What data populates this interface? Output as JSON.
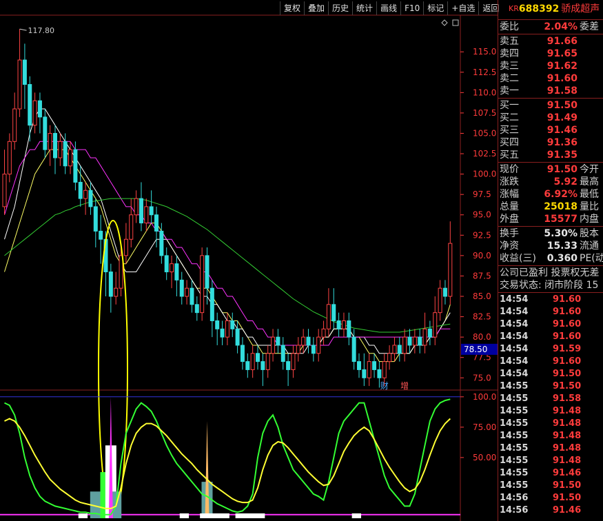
{
  "toolbar": [
    "复权",
    "叠加",
    "历史",
    "统计",
    "画线",
    "F10",
    "标记",
    "+自选",
    "返回"
  ],
  "chart_data": {
    "type": "candlestick",
    "price_axis": [
      115.0,
      112.5,
      110.0,
      107.5,
      105.0,
      102.5,
      100.0,
      97.5,
      95.0,
      92.5,
      90.0,
      87.5,
      85.0,
      82.5,
      80.0,
      77.5,
      75.0
    ],
    "ylim": [
      73.5,
      119.5
    ],
    "max_label": "117.80",
    "current_tag": "78.50",
    "markers": [
      "财",
      "增"
    ],
    "candles": [
      [
        96,
        100,
        95,
        103
      ],
      [
        100,
        104,
        99,
        105
      ],
      [
        104,
        108,
        103,
        110
      ],
      [
        108,
        114,
        107,
        117.8
      ],
      [
        114,
        111,
        108,
        116
      ],
      [
        111,
        106,
        104,
        112
      ],
      [
        106,
        109,
        105,
        110
      ],
      [
        109,
        107,
        105,
        110
      ],
      [
        107,
        103,
        102,
        108
      ],
      [
        103,
        105,
        101,
        106
      ],
      [
        105,
        102,
        100,
        106
      ],
      [
        102,
        104,
        101,
        105
      ],
      [
        104,
        101,
        100,
        105
      ],
      [
        101,
        103,
        100,
        104
      ],
      [
        103,
        99,
        98,
        104
      ],
      [
        99,
        97,
        96,
        101
      ],
      [
        97,
        98,
        95,
        99
      ],
      [
        98,
        96,
        95,
        99
      ],
      [
        96,
        93,
        91,
        97
      ],
      [
        93,
        92,
        89,
        95
      ],
      [
        92,
        88,
        85,
        93
      ],
      [
        88,
        85,
        83,
        89
      ],
      [
        85,
        86,
        84,
        88
      ],
      [
        86,
        90,
        85,
        91
      ],
      [
        90,
        92,
        89,
        94
      ],
      [
        92,
        95,
        91,
        97
      ],
      [
        95,
        97,
        94,
        98
      ],
      [
        97,
        94,
        93,
        99
      ],
      [
        94,
        96,
        93,
        97
      ],
      [
        96,
        95,
        94,
        98
      ],
      [
        95,
        93,
        91,
        96
      ],
      [
        93,
        90,
        89,
        94
      ],
      [
        90,
        88,
        87,
        91
      ],
      [
        88,
        89,
        86,
        90
      ],
      [
        89,
        87,
        85,
        90
      ],
      [
        87,
        85,
        84,
        88
      ],
      [
        85,
        86,
        84,
        87
      ],
      [
        86,
        84,
        83,
        87
      ],
      [
        84,
        83,
        82,
        85
      ],
      [
        83,
        90,
        82,
        91
      ],
      [
        90,
        86,
        84,
        91
      ],
      [
        86,
        82,
        80,
        87
      ],
      [
        82,
        81,
        79,
        83
      ],
      [
        81,
        80,
        79,
        82
      ],
      [
        80,
        82,
        79,
        83
      ],
      [
        82,
        81,
        80,
        83
      ],
      [
        81,
        79,
        78,
        82
      ],
      [
        79,
        77,
        76,
        80
      ],
      [
        77,
        76,
        75,
        78
      ],
      [
        76,
        78,
        75,
        79
      ],
      [
        78,
        77,
        76,
        79
      ],
      [
        77,
        76,
        74,
        78
      ],
      [
        76,
        78,
        75,
        79
      ],
      [
        78,
        80,
        77,
        81
      ],
      [
        80,
        79,
        78,
        81
      ],
      [
        79,
        77,
        76,
        80
      ],
      [
        77,
        76,
        74,
        78
      ],
      [
        76,
        78,
        75,
        79
      ],
      [
        78,
        79,
        77,
        80
      ],
      [
        79,
        80,
        78,
        81
      ],
      [
        80,
        79,
        78,
        81
      ],
      [
        79,
        78,
        77,
        80
      ],
      [
        78,
        80,
        77,
        81
      ],
      [
        80,
        81,
        79,
        82
      ],
      [
        81,
        84,
        80,
        86
      ],
      [
        84,
        82,
        81,
        86
      ],
      [
        82,
        81,
        80,
        83
      ],
      [
        81,
        82,
        80,
        83
      ],
      [
        82,
        80,
        79,
        83
      ],
      [
        80,
        77,
        76,
        81
      ],
      [
        77,
        76,
        75,
        78
      ],
      [
        76,
        75,
        74,
        78
      ],
      [
        75,
        77,
        74,
        78
      ],
      [
        77,
        76,
        75,
        78
      ],
      [
        76,
        75,
        73.8,
        77
      ],
      [
        75,
        77,
        74,
        78
      ],
      [
        77,
        78,
        76,
        79
      ],
      [
        78,
        79,
        77,
        80
      ],
      [
        79,
        78,
        77,
        80
      ],
      [
        78,
        80,
        77,
        81
      ],
      [
        80,
        79,
        78,
        81
      ],
      [
        79,
        80,
        78,
        81
      ],
      [
        80,
        79,
        78,
        81
      ],
      [
        79,
        81,
        78,
        83
      ],
      [
        81,
        80,
        79,
        82
      ],
      [
        80,
        83,
        79,
        85
      ],
      [
        83,
        86,
        82,
        87
      ],
      [
        86,
        85,
        84,
        87
      ],
      [
        85,
        91.5,
        84,
        94.2
      ]
    ],
    "ma": {
      "yellow": [
        88,
        90,
        92,
        94,
        96,
        98,
        100,
        101,
        102,
        103,
        103,
        103,
        103,
        102,
        101,
        100,
        99,
        98,
        97,
        96,
        94,
        92,
        90,
        89,
        89,
        90,
        91,
        92,
        93,
        94,
        94,
        93,
        92,
        91,
        90,
        89,
        88,
        87,
        86,
        86,
        86,
        85,
        84,
        83,
        83,
        82,
        82,
        81,
        80,
        79,
        79,
        78,
        78,
        78,
        78,
        78,
        78,
        78,
        78,
        79,
        79,
        79,
        79,
        80,
        80,
        81,
        81,
        81,
        81,
        80,
        80,
        79,
        78,
        78,
        77,
        77,
        77,
        77,
        78,
        78,
        78,
        79,
        79,
        79,
        80,
        80,
        81,
        82,
        84
      ],
      "white": [
        92,
        94,
        96,
        99,
        102,
        105,
        107,
        108,
        108,
        107,
        106,
        105,
        104,
        103,
        102,
        101,
        100,
        99,
        98,
        97,
        95,
        93,
        91,
        89,
        88,
        88,
        88,
        89,
        90,
        91,
        92,
        92,
        92,
        91,
        90,
        89,
        88,
        87,
        86,
        85,
        85,
        84,
        84,
        83,
        82,
        82,
        81,
        81,
        80,
        80,
        79,
        79,
        79,
        79,
        79,
        79,
        78,
        78,
        78,
        78,
        79,
        79,
        79,
        80,
        80,
        81,
        81,
        81,
        81,
        80,
        80,
        80,
        79,
        79,
        78,
        78,
        78,
        78,
        78,
        78,
        78,
        79,
        79,
        79,
        80,
        80,
        81,
        82,
        83
      ],
      "magenta": [
        95,
        97,
        99,
        101,
        102,
        103,
        103,
        104,
        104,
        104,
        104,
        104,
        104,
        104,
        103,
        103,
        103,
        102,
        102,
        101,
        100,
        99,
        98,
        97,
        96,
        96,
        95,
        95,
        94,
        94,
        93,
        93,
        92,
        92,
        91,
        91,
        90,
        89,
        89,
        88,
        88,
        87,
        86,
        86,
        85,
        85,
        84,
        83,
        82,
        82,
        81,
        81,
        80,
        80,
        79,
        79,
        79,
        79,
        79,
        79,
        79,
        79,
        79,
        79,
        79,
        80,
        80,
        80,
        80,
        80,
        80,
        80,
        80,
        80,
        80,
        80,
        80,
        80,
        80,
        80,
        80,
        80,
        80,
        80,
        80,
        80,
        81,
        81,
        81
      ],
      "green": [
        90,
        90.5,
        91,
        91.5,
        92,
        92.5,
        93,
        93.5,
        94,
        94.5,
        95,
        95.2,
        95.5,
        95.7,
        96,
        96.2,
        96.4,
        96.6,
        96.7,
        96.8,
        96.9,
        97,
        97,
        97,
        97,
        97,
        97,
        96.9,
        96.8,
        96.6,
        96.4,
        96.2,
        96,
        95.7,
        95.4,
        95.1,
        94.8,
        94.4,
        94,
        93.6,
        93.2,
        92.7,
        92.2,
        91.7,
        91.2,
        90.7,
        90.2,
        89.7,
        89.2,
        88.7,
        88.2,
        87.7,
        87.2,
        86.7,
        86.2,
        85.7,
        85.2,
        84.7,
        84.3,
        83.9,
        83.5,
        83.1,
        82.8,
        82.5,
        82.2,
        81.9,
        81.7,
        81.5,
        81.3,
        81.1,
        81,
        80.9,
        80.8,
        80.7,
        80.6,
        80.6,
        80.6,
        80.6,
        80.6,
        80.7,
        80.8,
        80.9,
        81,
        81.1,
        81.2,
        81.3,
        81.4,
        81.5,
        81.6
      ]
    },
    "indicator": {
      "axis": [
        100.0,
        75.0,
        50.0
      ],
      "ylim": [
        0,
        105
      ],
      "green": [
        95,
        93,
        85,
        70,
        50,
        35,
        25,
        18,
        14,
        12,
        10,
        9,
        8,
        7,
        6,
        5,
        5,
        4,
        4,
        3,
        3,
        3,
        10,
        45,
        70,
        80,
        90,
        95,
        92,
        88,
        80,
        70,
        60,
        52,
        45,
        40,
        35,
        30,
        25,
        20,
        18,
        15,
        12,
        10,
        8,
        6,
        5,
        6,
        10,
        20,
        50,
        70,
        80,
        85,
        75,
        60,
        50,
        40,
        35,
        30,
        25,
        20,
        18,
        15,
        30,
        50,
        70,
        80,
        85,
        90,
        95,
        95,
        80,
        65,
        50,
        35,
        25,
        20,
        15,
        10,
        10,
        20,
        40,
        60,
        80,
        90,
        95,
        97,
        98
      ],
      "yellow": [
        80,
        82,
        80,
        75,
        68,
        60,
        52,
        45,
        38,
        32,
        28,
        24,
        21,
        18,
        15,
        13,
        12,
        11,
        10,
        9,
        8,
        8,
        10,
        25,
        45,
        60,
        70,
        75,
        78,
        78,
        76,
        72,
        68,
        63,
        58,
        53,
        49,
        45,
        40,
        36,
        32,
        28,
        25,
        22,
        19,
        16,
        14,
        13,
        13,
        15,
        25,
        40,
        52,
        60,
        63,
        62,
        58,
        53,
        48,
        43,
        38,
        34,
        30,
        27,
        28,
        35,
        45,
        55,
        62,
        68,
        72,
        75,
        72,
        65,
        57,
        49,
        42,
        36,
        30,
        25,
        22,
        24,
        30,
        40,
        52,
        63,
        72,
        78,
        82
      ],
      "bars": [
        {
          "i": 18,
          "h": 22,
          "c": "#5fa0a0"
        },
        {
          "i": 20,
          "h": 38,
          "c": "#33ff33"
        },
        {
          "i": 21,
          "h": 60,
          "c": "#ffffff"
        },
        {
          "i": 22,
          "h": 22,
          "c": "#5fa0a0"
        },
        {
          "i": 40,
          "h": 30,
          "c": "#5fa0a0"
        }
      ],
      "spikes": [
        {
          "i": 21,
          "v": 100,
          "c": "#ff33ff"
        },
        {
          "i": 40,
          "v": 80,
          "c": "#ffbb66"
        }
      ],
      "floor_bars": [
        [
          15,
          16
        ],
        [
          35,
          36
        ],
        [
          39,
          44
        ],
        [
          46,
          51
        ],
        [
          69,
          70
        ]
      ]
    }
  },
  "panel": {
    "stock": {
      "market": "KR",
      "code": "688392",
      "name": "骄成超声"
    },
    "webi": {
      "label": "委比",
      "value": "2.04%",
      "label2": "委差"
    },
    "asks": [
      {
        "label": "卖五",
        "price": "91.66"
      },
      {
        "label": "卖四",
        "price": "91.65"
      },
      {
        "label": "卖三",
        "price": "91.62"
      },
      {
        "label": "卖二",
        "price": "91.60"
      },
      {
        "label": "卖一",
        "price": "91.58"
      }
    ],
    "bids": [
      {
        "label": "买一",
        "price": "91.50"
      },
      {
        "label": "买二",
        "price": "91.49"
      },
      {
        "label": "买三",
        "price": "91.46"
      },
      {
        "label": "买四",
        "price": "91.36"
      },
      {
        "label": "买五",
        "price": "91.35"
      }
    ],
    "quote": [
      {
        "label": "现价",
        "value": "91.50",
        "label2": "今开",
        "cls": "red"
      },
      {
        "label": "涨跌",
        "value": "5.92",
        "label2": "最高",
        "cls": "red"
      },
      {
        "label": "涨幅",
        "value": "6.92%",
        "label2": "最低",
        "cls": "red"
      },
      {
        "label": "总量",
        "value": "25018",
        "label2": "量比",
        "cls": "yel"
      },
      {
        "label": "外盘",
        "value": "15577",
        "label2": "内盘",
        "cls": "red"
      }
    ],
    "fund": [
      {
        "label": "换手",
        "value": "5.30%",
        "label2": "股本"
      },
      {
        "label": "净资",
        "value": "15.33",
        "label2": "流通"
      },
      {
        "label": "收益(三)",
        "value": "0.360",
        "label2": "PE(动"
      }
    ],
    "notes": [
      "公司已盈利 投票权无差",
      "交易状态: 闭市阶段 15"
    ],
    "ticks": [
      {
        "t": "14:54",
        "p": "91.60"
      },
      {
        "t": "14:54",
        "p": "91.60"
      },
      {
        "t": "14:54",
        "p": "91.60"
      },
      {
        "t": "14:54",
        "p": "91.60"
      },
      {
        "t": "14:54",
        "p": "91.59"
      },
      {
        "t": "14:54",
        "p": "91.60"
      },
      {
        "t": "14:54",
        "p": "91.50"
      },
      {
        "t": "14:55",
        "p": "91.50"
      },
      {
        "t": "14:55",
        "p": "91.58"
      },
      {
        "t": "14:55",
        "p": "91.48"
      },
      {
        "t": "14:55",
        "p": "91.48"
      },
      {
        "t": "14:55",
        "p": "91.48"
      },
      {
        "t": "14:55",
        "p": "91.48"
      },
      {
        "t": "14:55",
        "p": "91.48"
      },
      {
        "t": "14:55",
        "p": "91.46"
      },
      {
        "t": "14:55",
        "p": "91.50"
      },
      {
        "t": "14:56",
        "p": "91.50"
      },
      {
        "t": "14:56",
        "p": "91.46"
      }
    ]
  }
}
